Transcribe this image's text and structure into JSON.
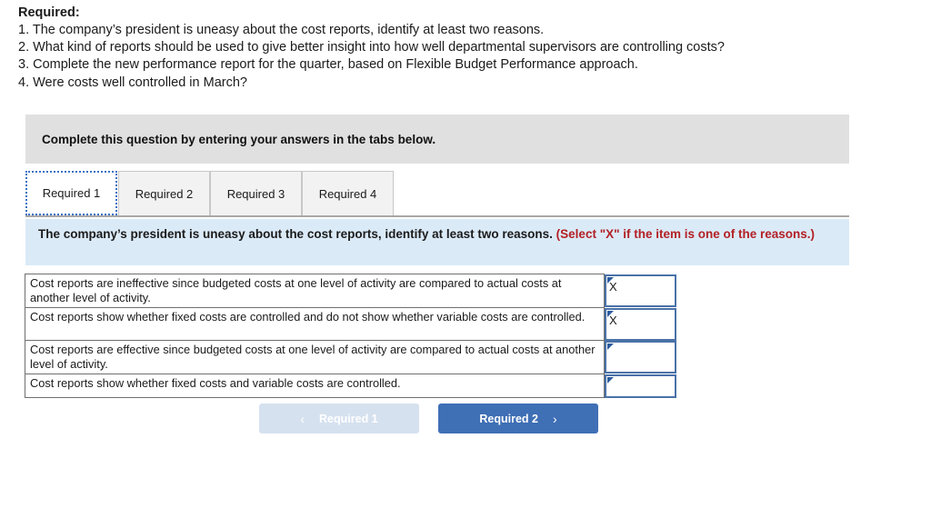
{
  "required": {
    "heading": "Required:",
    "items": [
      "1. The company’s president is uneasy about the cost reports, identify at least two reasons.",
      "2. What kind of reports should be used to give better insight into how well departmental supervisors are controlling costs?",
      "3. Complete the new performance report for the quarter, based on Flexible Budget Performance approach.",
      "4. Were costs well controlled in March?"
    ]
  },
  "instruction_banner": {
    "text": "Complete this question by entering your answers in the tabs below."
  },
  "tabs": [
    {
      "label": "Required 1",
      "active": true
    },
    {
      "label": "Required 2",
      "active": false
    },
    {
      "label": "Required 3",
      "active": false
    },
    {
      "label": "Required 4",
      "active": false
    }
  ],
  "info_bar": {
    "question": "The company’s president is uneasy about the cost reports, identify at least two reasons.",
    "note": "(Select \"X\" if the item is one of the reasons.)"
  },
  "answer_table": {
    "rows": [
      {
        "statement": "Cost reports are ineffective since budgeted costs at one level of activity are compared to actual costs at another level of activity.",
        "answer": "X"
      },
      {
        "statement": "Cost reports show whether fixed costs are controlled and do not show whether variable costs are controlled.",
        "answer": "X"
      },
      {
        "statement": "Cost reports are effective since budgeted costs at one level of activity are compared to actual costs at another level of activity.",
        "answer": ""
      },
      {
        "statement": "Cost reports show whether fixed costs and variable costs are controlled.",
        "answer": ""
      }
    ]
  },
  "nav": {
    "prev_label": "Required 1",
    "next_label": "Required 2",
    "prev_chevron": "‹",
    "next_chevron": "›"
  },
  "colors": {
    "banner_gray": "#e0e0e0",
    "info_blue": "#dbeaf7",
    "note_red": "#b32025",
    "input_border_blue": "#4a72a8",
    "marker_blue": "#2c5c9e",
    "next_button_blue": "#3f6fb5",
    "prev_button_blue": "#d6e1ef",
    "tab_focus_blue": "#3a72c4"
  }
}
